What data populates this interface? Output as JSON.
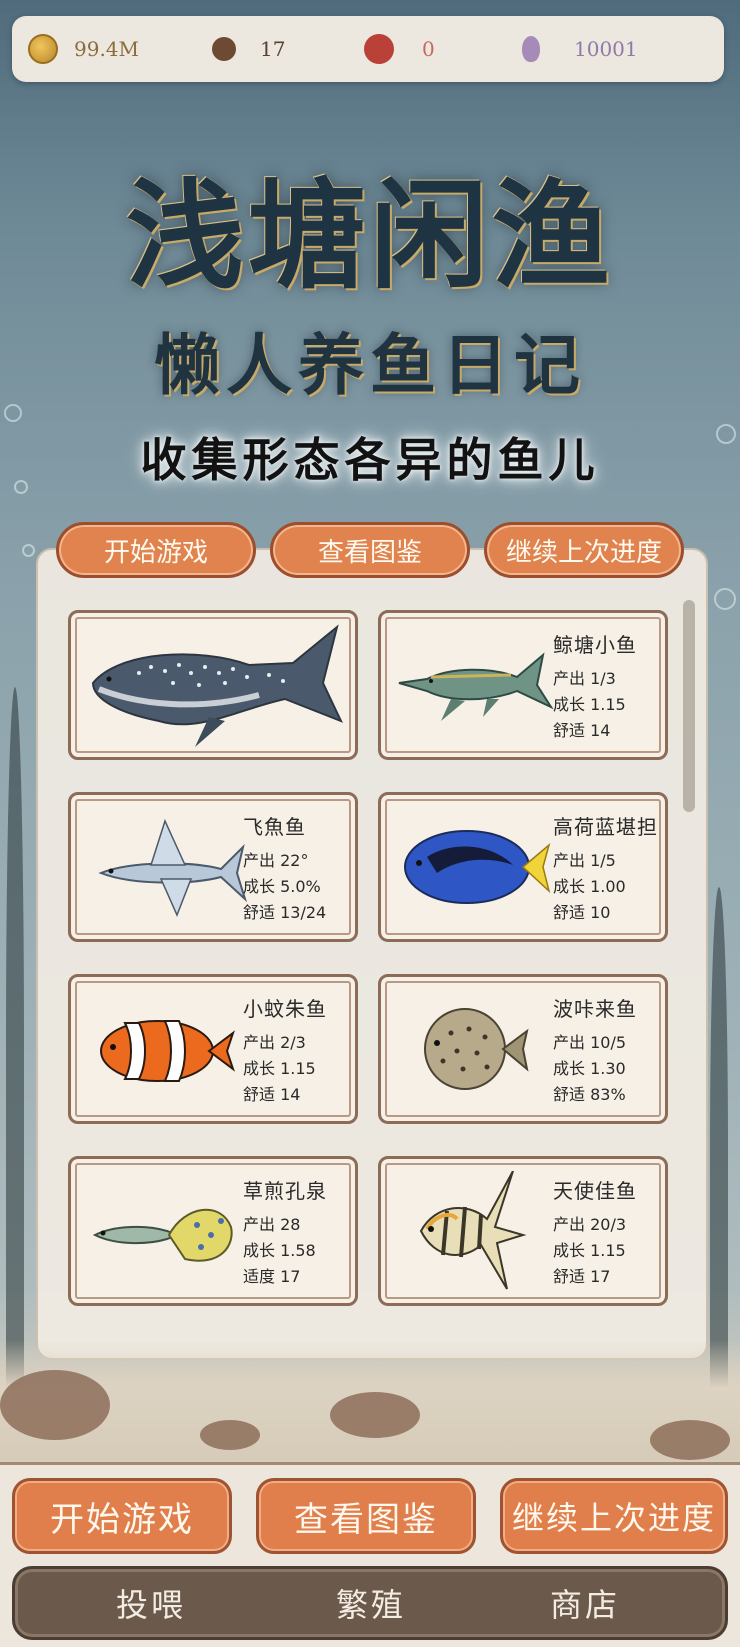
{
  "status": {
    "coins": "99.4M",
    "beans": "17",
    "pearls": "0",
    "gourds": "10001"
  },
  "title": {
    "main": "浅塘闲渔",
    "sub": "懒人养鱼日记",
    "tagline": "收集形态各异的鱼儿"
  },
  "top_buttons": {
    "start": "开始游戏",
    "catalog": "查看图鉴",
    "continue": "继续上次进度"
  },
  "fish_cards": [
    {
      "name": "",
      "stats": [],
      "art": "whale-shark-icon"
    },
    {
      "name": "鲸塘小鱼",
      "stats": [
        "产出 1/3",
        "成长 1.15",
        "舒适 14"
      ],
      "art": "sturgeon-icon"
    },
    {
      "name": "飞魚鱼",
      "stats": [
        "产出 22°",
        "成长 5.0%",
        "舒适 13/24"
      ],
      "art": "flying-fish-icon"
    },
    {
      "name": "高荷蓝堪担",
      "stats": [
        "产出 1/5",
        "成长 1.00",
        "舒适 10"
      ],
      "art": "blue-tang-icon"
    },
    {
      "name": "小蚊朱鱼",
      "stats": [
        "产出 2/3",
        "成长 1.15",
        "舒适 14"
      ],
      "art": "clownfish-icon"
    },
    {
      "name": "波咔来鱼",
      "stats": [
        "产出 10/5",
        "成长 1.30",
        "舒适 83%"
      ],
      "art": "pufferfish-icon"
    },
    {
      "name": "草煎孔泉",
      "stats": [
        "产出 28",
        "成长 1.58",
        "适度 17"
      ],
      "art": "guppy-icon"
    },
    {
      "name": "天使佳鱼",
      "stats": [
        "产出 20/3",
        "成长 1.15",
        "舒适 17"
      ],
      "art": "angelfish-icon"
    }
  ],
  "bottom_buttons": {
    "start": "开始游戏",
    "catalog": "查看图鉴",
    "continue": "继续上次进度"
  },
  "nav": {
    "feed": "投喂",
    "breed": "繁殖",
    "shop": "商店"
  },
  "colors": {
    "accent_orange": "#e0834f",
    "nav_brown": "#6b5a4c",
    "water_blue": "#6f8a97"
  }
}
